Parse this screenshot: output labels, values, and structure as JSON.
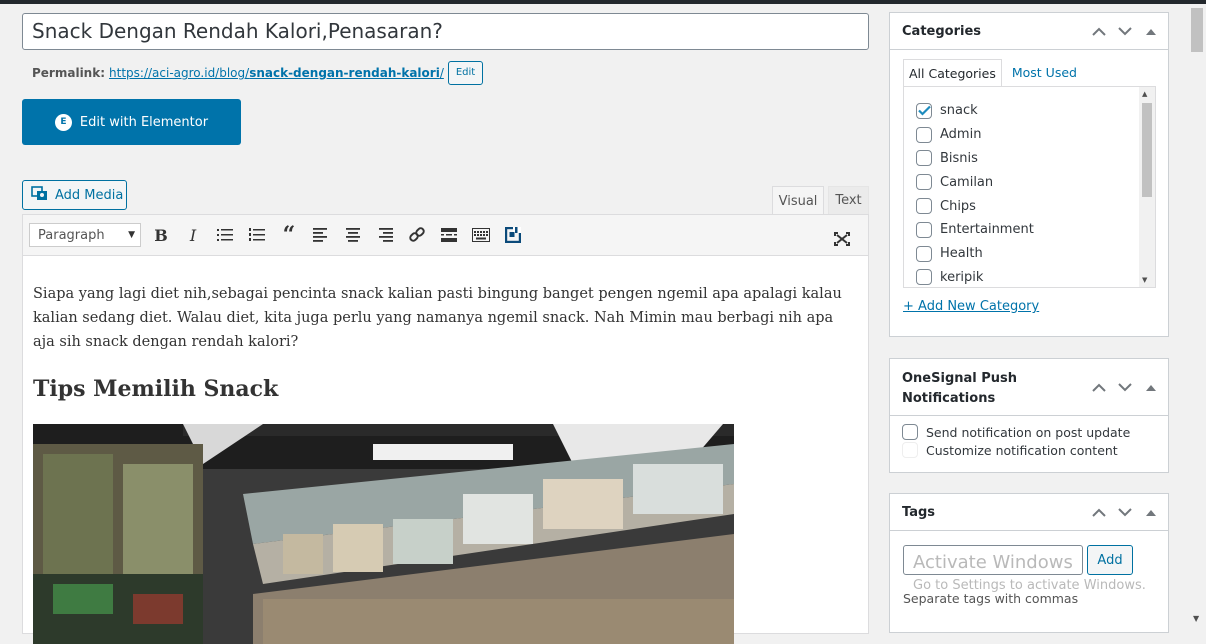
{
  "title": {
    "value": "Snack Dengan Rendah Kalori,Penasaran?"
  },
  "permalink": {
    "label": "Permalink:",
    "url_base": "https://aci-agro.id/blog/",
    "url_slug": "snack-dengan-rendah-kalori",
    "url_end": "/",
    "edit_label": "Edit"
  },
  "elementor_button": {
    "label": "Edit with Elementor",
    "icon_glyph": "E"
  },
  "add_media": {
    "label": "Add Media"
  },
  "editor_tabs": {
    "visual": "Visual",
    "text": "Text"
  },
  "toolbar": {
    "format_value": "Paragraph",
    "buttons": [
      "bold",
      "italic",
      "bullet-list",
      "numbered-list",
      "blockquote",
      "align-left",
      "align-center",
      "align-right",
      "link",
      "read-more",
      "toolbar-toggle",
      "insert-block",
      "fullscreen"
    ]
  },
  "content": {
    "paragraph": "Siapa yang lagi diet nih,sebagai pencinta snack kalian pasti bingung banget pengen ngemil apa apalagi kalau kalian sedang diet. Walau diet, kita juga perlu yang namanya ngemil snack. Nah Mimin mau berbagi nih apa aja sih snack dengan rendah kalori?",
    "heading": "Tips Memilih Snack"
  },
  "categories": {
    "title": "Categories",
    "tab_all": "All Categories",
    "tab_used": "Most Used",
    "items": [
      {
        "label": "snack",
        "checked": true
      },
      {
        "label": "Admin",
        "checked": false
      },
      {
        "label": "Bisnis",
        "checked": false
      },
      {
        "label": "Camilan",
        "checked": false
      },
      {
        "label": "Chips",
        "checked": false
      },
      {
        "label": "Entertainment",
        "checked": false
      },
      {
        "label": "Health",
        "checked": false
      },
      {
        "label": "keripik",
        "checked": false
      }
    ],
    "add_new": "+ Add New Category"
  },
  "onesignal": {
    "title_line1": "OneSignal Push",
    "title_line2": "Notifications",
    "send_label": "Send notification on post update",
    "customize_label": "Customize notification content"
  },
  "tags": {
    "title": "Tags",
    "add_label": "Add",
    "hint": "Separate tags with commas"
  },
  "watermark": {
    "line1": "Activate Windows",
    "line2": "Go to Settings to activate Windows."
  },
  "colors": {
    "accent": "#0073aa",
    "border": "#ccd0d4"
  }
}
